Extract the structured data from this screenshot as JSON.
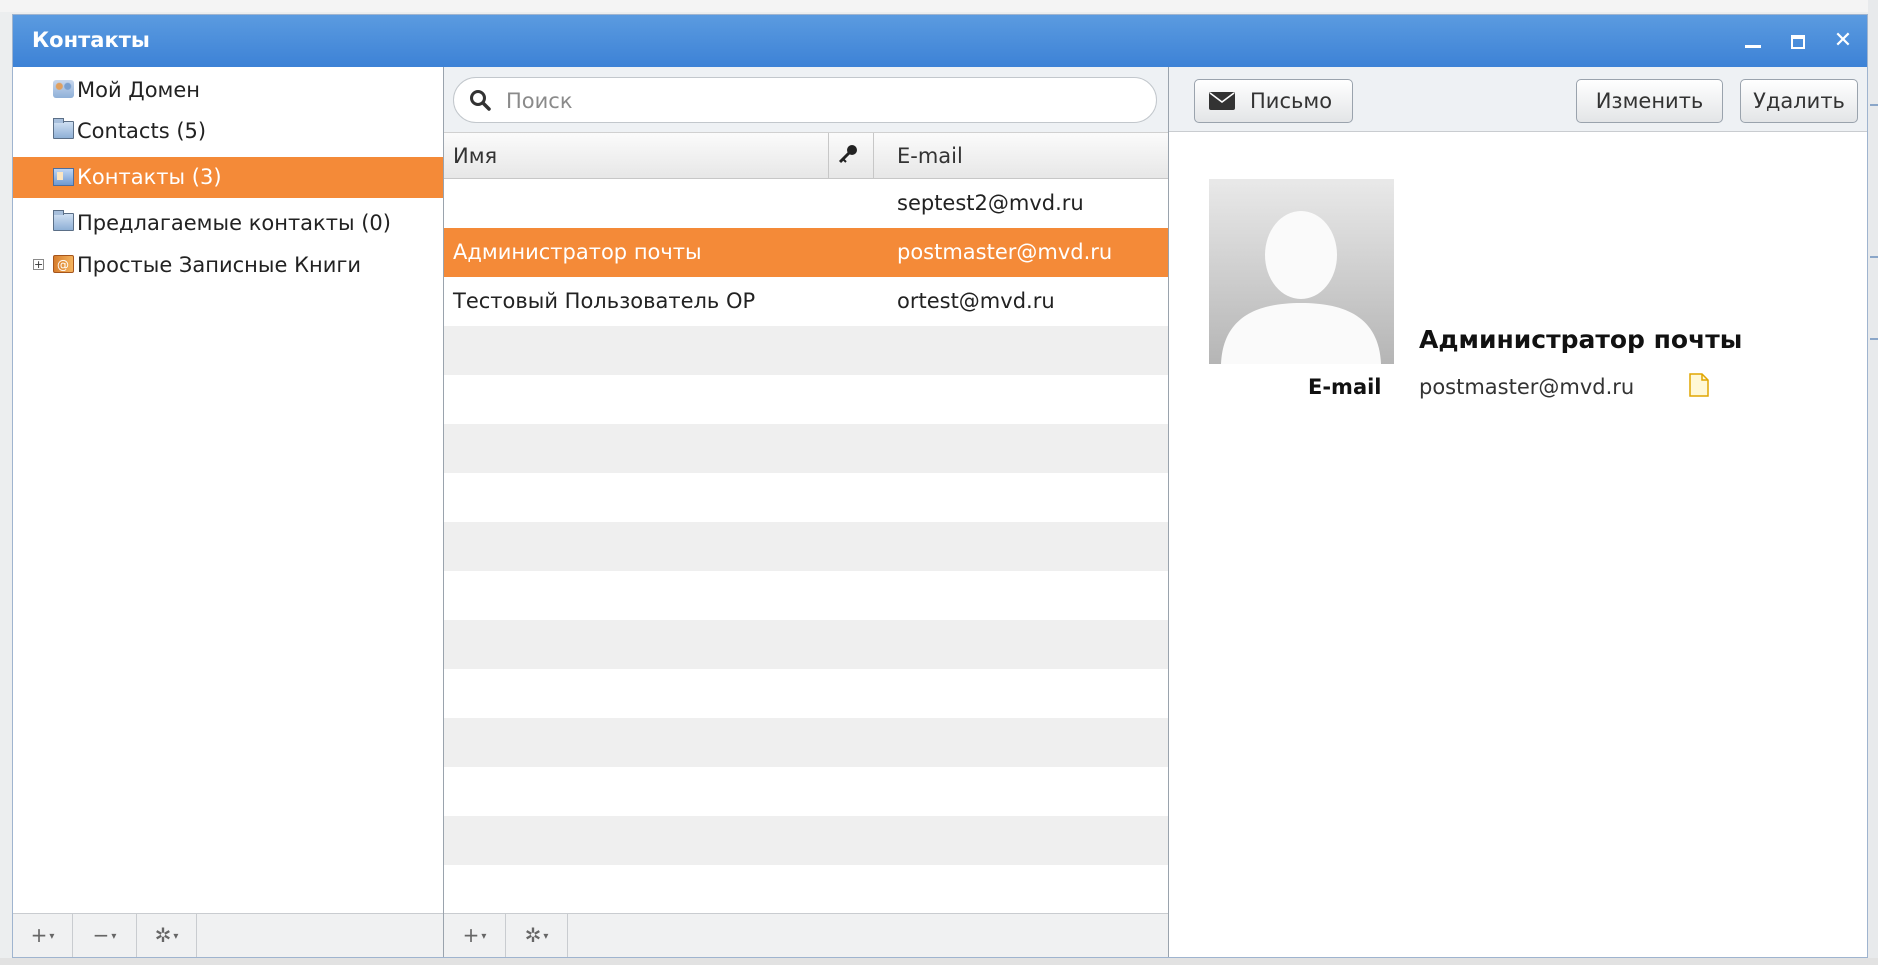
{
  "window": {
    "title": "Контакты"
  },
  "tree": {
    "items": [
      {
        "label": "Мой Домен",
        "icon": "domain-icon"
      },
      {
        "label": "Contacts (5)",
        "icon": "folder-icon"
      },
      {
        "label": "Контакты (3)",
        "icon": "contact-card-icon",
        "selected": true
      },
      {
        "label": "Предлагаемые контакты (0)",
        "icon": "folder-icon"
      },
      {
        "label": "Простые Записные Книги",
        "icon": "address-book-icon",
        "expander": "+"
      }
    ],
    "toolbar": {
      "add": "+",
      "remove": "−",
      "settings": "✲"
    }
  },
  "list": {
    "search_placeholder": "Поиск",
    "columns": {
      "name": "Имя",
      "email": "E-mail"
    },
    "rows": [
      {
        "name": "",
        "email": "septest2@mvd.ru"
      },
      {
        "name": "Администратор почты",
        "email": "postmaster@mvd.ru",
        "selected": true
      },
      {
        "name": "Тестовый Пользователь ОР",
        "email": "ortest@mvd.ru"
      }
    ],
    "toolbar": {
      "add": "+",
      "settings": "✲"
    }
  },
  "detail": {
    "toolbar": {
      "mail": "Письмо",
      "edit": "Изменить",
      "delete": "Удалить"
    },
    "contact": {
      "name": "Администратор почты",
      "field_label": "E-mail",
      "field_value": "postmaster@mvd.ru"
    }
  },
  "colors": {
    "titlebar": "#4a8edb",
    "selection": "#f48a38"
  }
}
